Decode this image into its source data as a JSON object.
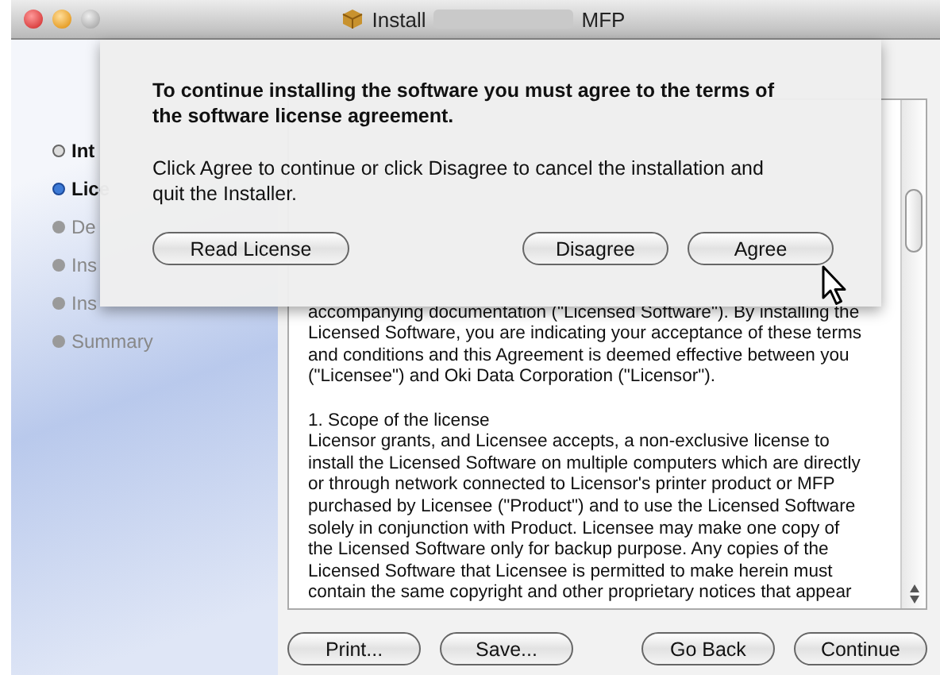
{
  "window": {
    "title_start": "Install",
    "title_end": "MFP"
  },
  "sidebar": {
    "items": [
      {
        "label": "Int",
        "done": true,
        "current": false
      },
      {
        "label": "Lice",
        "done": false,
        "current": true
      },
      {
        "label": "De",
        "done": false,
        "current": false
      },
      {
        "label": "Ins",
        "done": false,
        "current": false
      },
      {
        "label": "Ins",
        "done": false,
        "current": false
      },
      {
        "label": "Summary",
        "done": false,
        "current": false
      }
    ]
  },
  "license_text": [
    {
      "kind": "line",
      "text": "accompanying documentation (\"Licensed Software\"). By installing the"
    },
    {
      "kind": "line",
      "text": "Licensed Software, you are indicating your acceptance of these terms"
    },
    {
      "kind": "line",
      "text": "and conditions and this Agreement is deemed effective between you"
    },
    {
      "kind": "line",
      "text": "(\"Licensee\") and Oki Data Corporation (\"Licensor\")."
    },
    {
      "kind": "gap"
    },
    {
      "kind": "line",
      "text": "1.  Scope of the license"
    },
    {
      "kind": "line",
      "text": "Licensor grants, and Licensee accepts, a non-exclusive license to"
    },
    {
      "kind": "line",
      "text": "install the Licensed Software on multiple computers which are directly"
    },
    {
      "kind": "line",
      "text": "or through network connected to Licensor's printer product or MFP"
    },
    {
      "kind": "line",
      "text": "purchased by Licensee (\"Product\") and to use the Licensed Software"
    },
    {
      "kind": "line",
      "text": "solely in conjunction with Product. Licensee may make one copy of"
    },
    {
      "kind": "line",
      "text": "the Licensed Software only for backup purpose. Any copies of the"
    },
    {
      "kind": "line",
      "text": "Licensed Software that Licensee is permitted to make herein must"
    },
    {
      "kind": "line",
      "text": "contain the same copyright and other proprietary notices that appear"
    }
  ],
  "bottom_buttons_left": [
    "Print...",
    "Save..."
  ],
  "bottom_buttons_right": [
    "Go Back",
    "Continue"
  ],
  "sheet": {
    "heading": "To continue installing the software you must agree to the terms of the software license agreement.",
    "message": "Click Agree to continue or click Disagree to cancel the installation and quit the Installer.",
    "left_button": "Read License",
    "right_buttons": [
      "Disagree",
      "Agree"
    ]
  }
}
